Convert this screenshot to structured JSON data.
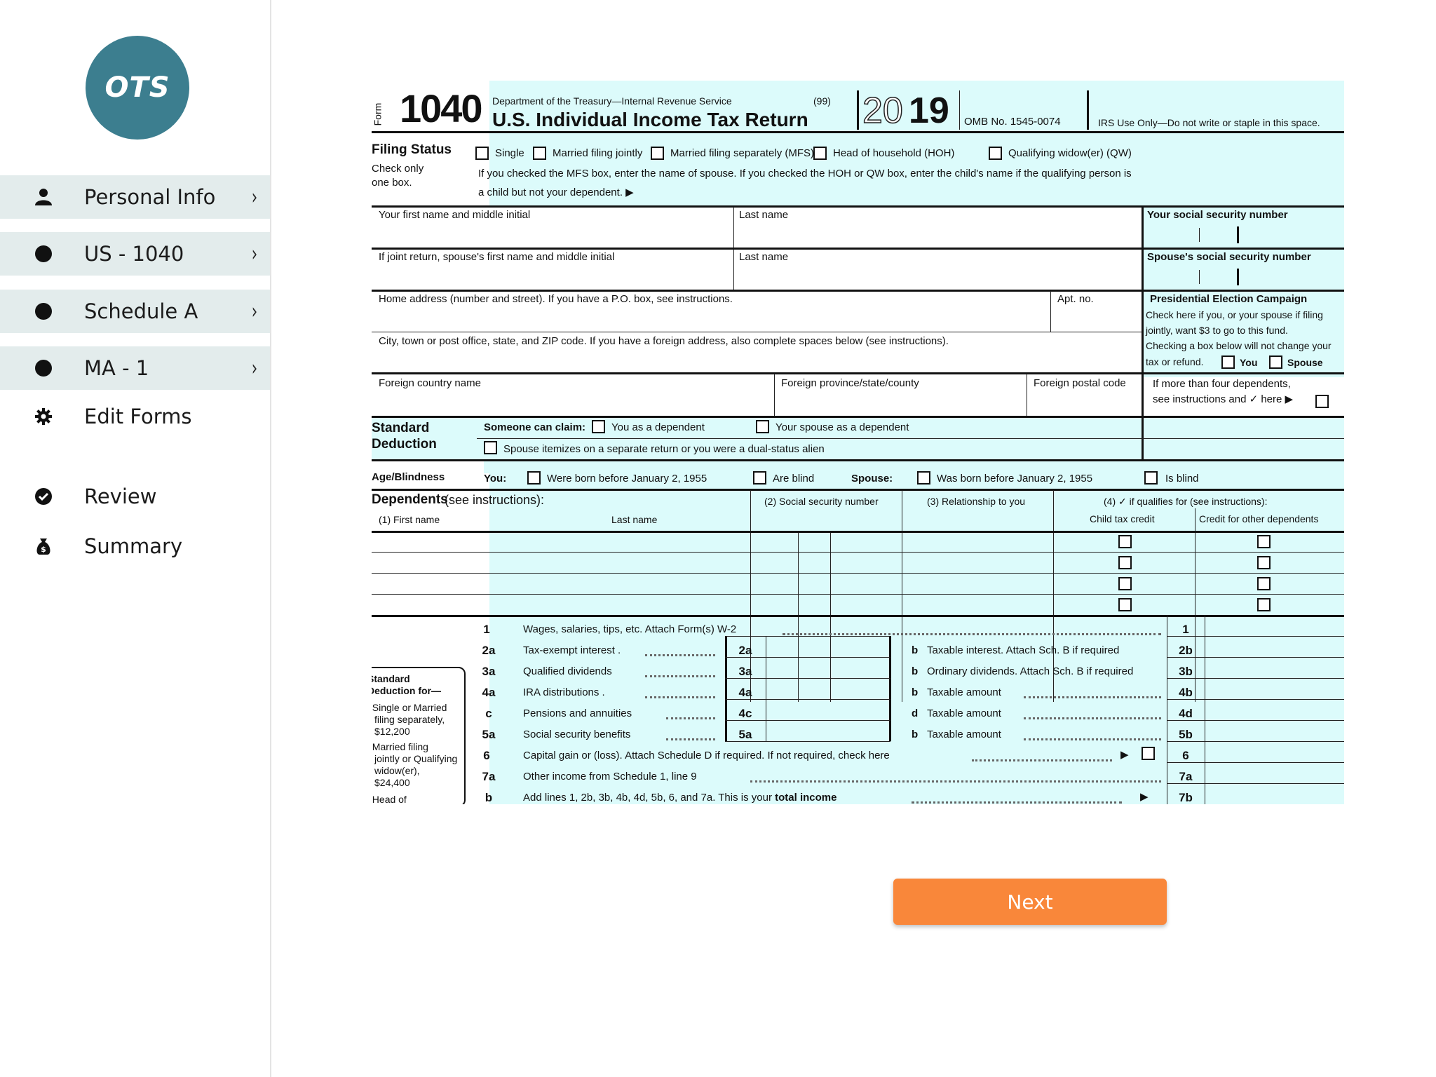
{
  "sidebar": {
    "logo_text": "OTS",
    "items": [
      {
        "label": "Personal Info",
        "icon": "person-icon",
        "chevron": "›"
      },
      {
        "label": "US - 1040",
        "icon": "dot-icon",
        "chevron": "›"
      },
      {
        "label": "Schedule A",
        "icon": "dot-icon",
        "chevron": "›"
      },
      {
        "label": "MA - 1",
        "icon": "dot-icon",
        "chevron": "›"
      },
      {
        "label": "Edit Forms",
        "icon": "gear-icon"
      },
      {
        "label": "Review",
        "icon": "check-circle-icon"
      },
      {
        "label": "Summary",
        "icon": "money-bag-icon"
      }
    ]
  },
  "form": {
    "form_word": "Form",
    "form_number": "1040",
    "dept": "Department of the Treasury—Internal Revenue Service",
    "code": "(99)",
    "title": "U.S. Individual Income Tax Return",
    "year_light": "20",
    "year_bold": "19",
    "omb": "OMB No. 1545-0074",
    "irs_use": "IRS Use Only—Do not write or staple in this space.",
    "filing_status": {
      "heading": "Filing Status",
      "sub1": "Check only",
      "sub2": "one box.",
      "options": [
        "Single",
        "Married filing jointly",
        "Married filing separately (MFS)",
        "Head of household (HOH)",
        "Qualifying widow(er) (QW)"
      ],
      "note1": "If you checked the MFS box, enter the name of spouse. If you checked the HOH or QW box, enter the child's name if the qualifying person is",
      "note2": "a child but not your dependent. ▶"
    },
    "name": {
      "first": "Your first name and middle initial",
      "last": "Last name",
      "ssn": "Your social security number",
      "spouse_first": "If joint return, spouse's first name and middle initial",
      "spouse_last": "Last name",
      "spouse_ssn": "Spouse's social security number"
    },
    "address": {
      "home": "Home address (number and street). If you have a P.O. box, see instructions.",
      "apt": "Apt. no.",
      "city": "City, town or post office, state, and ZIP code. If you have a foreign address, also complete spaces below (see instructions).",
      "country": "Foreign country name",
      "province": "Foreign province/state/county",
      "postal": "Foreign postal code"
    },
    "pec": {
      "title": "Presidential Election Campaign",
      "l1": "Check here if you, or your spouse if filing",
      "l2": "jointly, want $3 to go to this fund.",
      "l3": "Checking a box below will not change your",
      "l4": "tax or refund.",
      "you": "You",
      "spouse": "Spouse"
    },
    "dependents_note1": "If more than four dependents,",
    "dependents_note2": "see instructions and ✓ here ▶",
    "std_deduction": {
      "heading1": "Standard",
      "heading2": "Deduction",
      "claim": "Someone can claim:",
      "opt1": "You as a dependent",
      "opt2": "Your spouse as a dependent",
      "itemize": "Spouse itemizes on a separate return or you were a dual-status alien"
    },
    "age": {
      "heading": "Age/Blindness",
      "you": "You:",
      "born": "Were born before January 2, 1955",
      "blind": "Are blind",
      "spouse": "Spouse:",
      "sborn": "Was born before January 2, 1955",
      "sblind": "Is blind"
    },
    "dependents": {
      "heading": "Dependents",
      "heading_rest": " (see instructions):",
      "c1": "(1) First name",
      "c1b": "Last name",
      "c2": "(2) Social security number",
      "c3": "(3) Relationship to you",
      "c4": "(4) ✓ if qualifies for (see instructions):",
      "c4a": "Child tax credit",
      "c4b": "Credit for other dependents"
    },
    "sidebox": {
      "t1": "Standard",
      "t2": "Deduction for—",
      "b1a": "• Single or Married",
      "b1b": "filing separately,",
      "b1c": "$12,200",
      "b2a": "• Married filing",
      "b2b": "jointly or Qualifying",
      "b2c": "widow(er),",
      "b2d": "$24,400",
      "b3a": "• Head of"
    },
    "lines": {
      "l1": {
        "num": "1",
        "text": "Wages, salaries, tips, etc. Attach Form(s) W-2",
        "box": "1"
      },
      "l2a": {
        "num": "2a",
        "text": "Tax-exempt interest .",
        "box": "2a",
        "rnum": "b",
        "rtext": "Taxable interest. Attach Sch. B if required",
        "rbox": "2b"
      },
      "l3a": {
        "num": "3a",
        "text": "Qualified dividends",
        "box": "3a",
        "rnum": "b",
        "rtext": "Ordinary dividends. Attach Sch. B if required",
        "rbox": "3b"
      },
      "l4a": {
        "num": "4a",
        "text": "IRA distributions .",
        "box": "4a",
        "rnum": "b",
        "rtext": "Taxable amount",
        "rbox": "4b"
      },
      "l4c": {
        "num": "c",
        "text": "Pensions and annuities",
        "box": "4c",
        "rnum": "d",
        "rtext": "Taxable amount",
        "rbox": "4d"
      },
      "l5a": {
        "num": "5a",
        "text": "Social security benefits",
        "box": "5a",
        "rnum": "b",
        "rtext": "Taxable amount",
        "rbox": "5b"
      },
      "l6": {
        "num": "6",
        "text": "Capital gain or (loss). Attach Schedule D if required. If not required, check here",
        "arrow": "▶",
        "box": "6"
      },
      "l7a": {
        "num": "7a",
        "text": "Other income from Schedule 1, line 9",
        "box": "7a"
      },
      "l7b": {
        "num": "b",
        "text": "Add lines 1, 2b, 3b, 4b, 4d, 5b, 6, and 7a. This is your ",
        "bold": "total income",
        "arrow": "▶",
        "box": "7b"
      }
    }
  },
  "next_button": {
    "label": "Next"
  }
}
